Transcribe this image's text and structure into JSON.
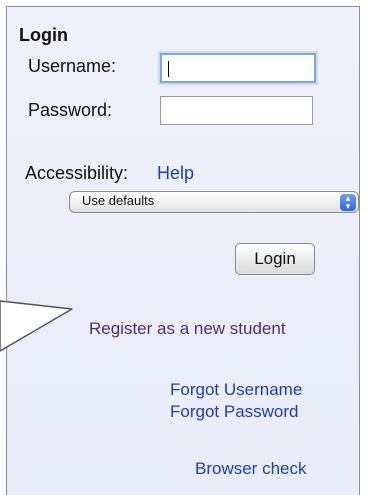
{
  "login": {
    "title": "Login",
    "username_label": "Username:",
    "username_value": "",
    "password_label": "Password:",
    "password_value": "",
    "accessibility_label": "Accessibility:",
    "help_link": "Help",
    "accessibility_select_value": "Use defaults",
    "login_button": "Login"
  },
  "links": {
    "register": "Register as a new student",
    "forgot_username": "Forgot Username",
    "forgot_password": "Forgot Password",
    "browser_check": "Browser check"
  },
  "colors": {
    "link": "#1e3fb2",
    "visited_link": "#4b2f7a",
    "panel_background": "#eceefa",
    "focus_ring": "#7ea7e3"
  }
}
